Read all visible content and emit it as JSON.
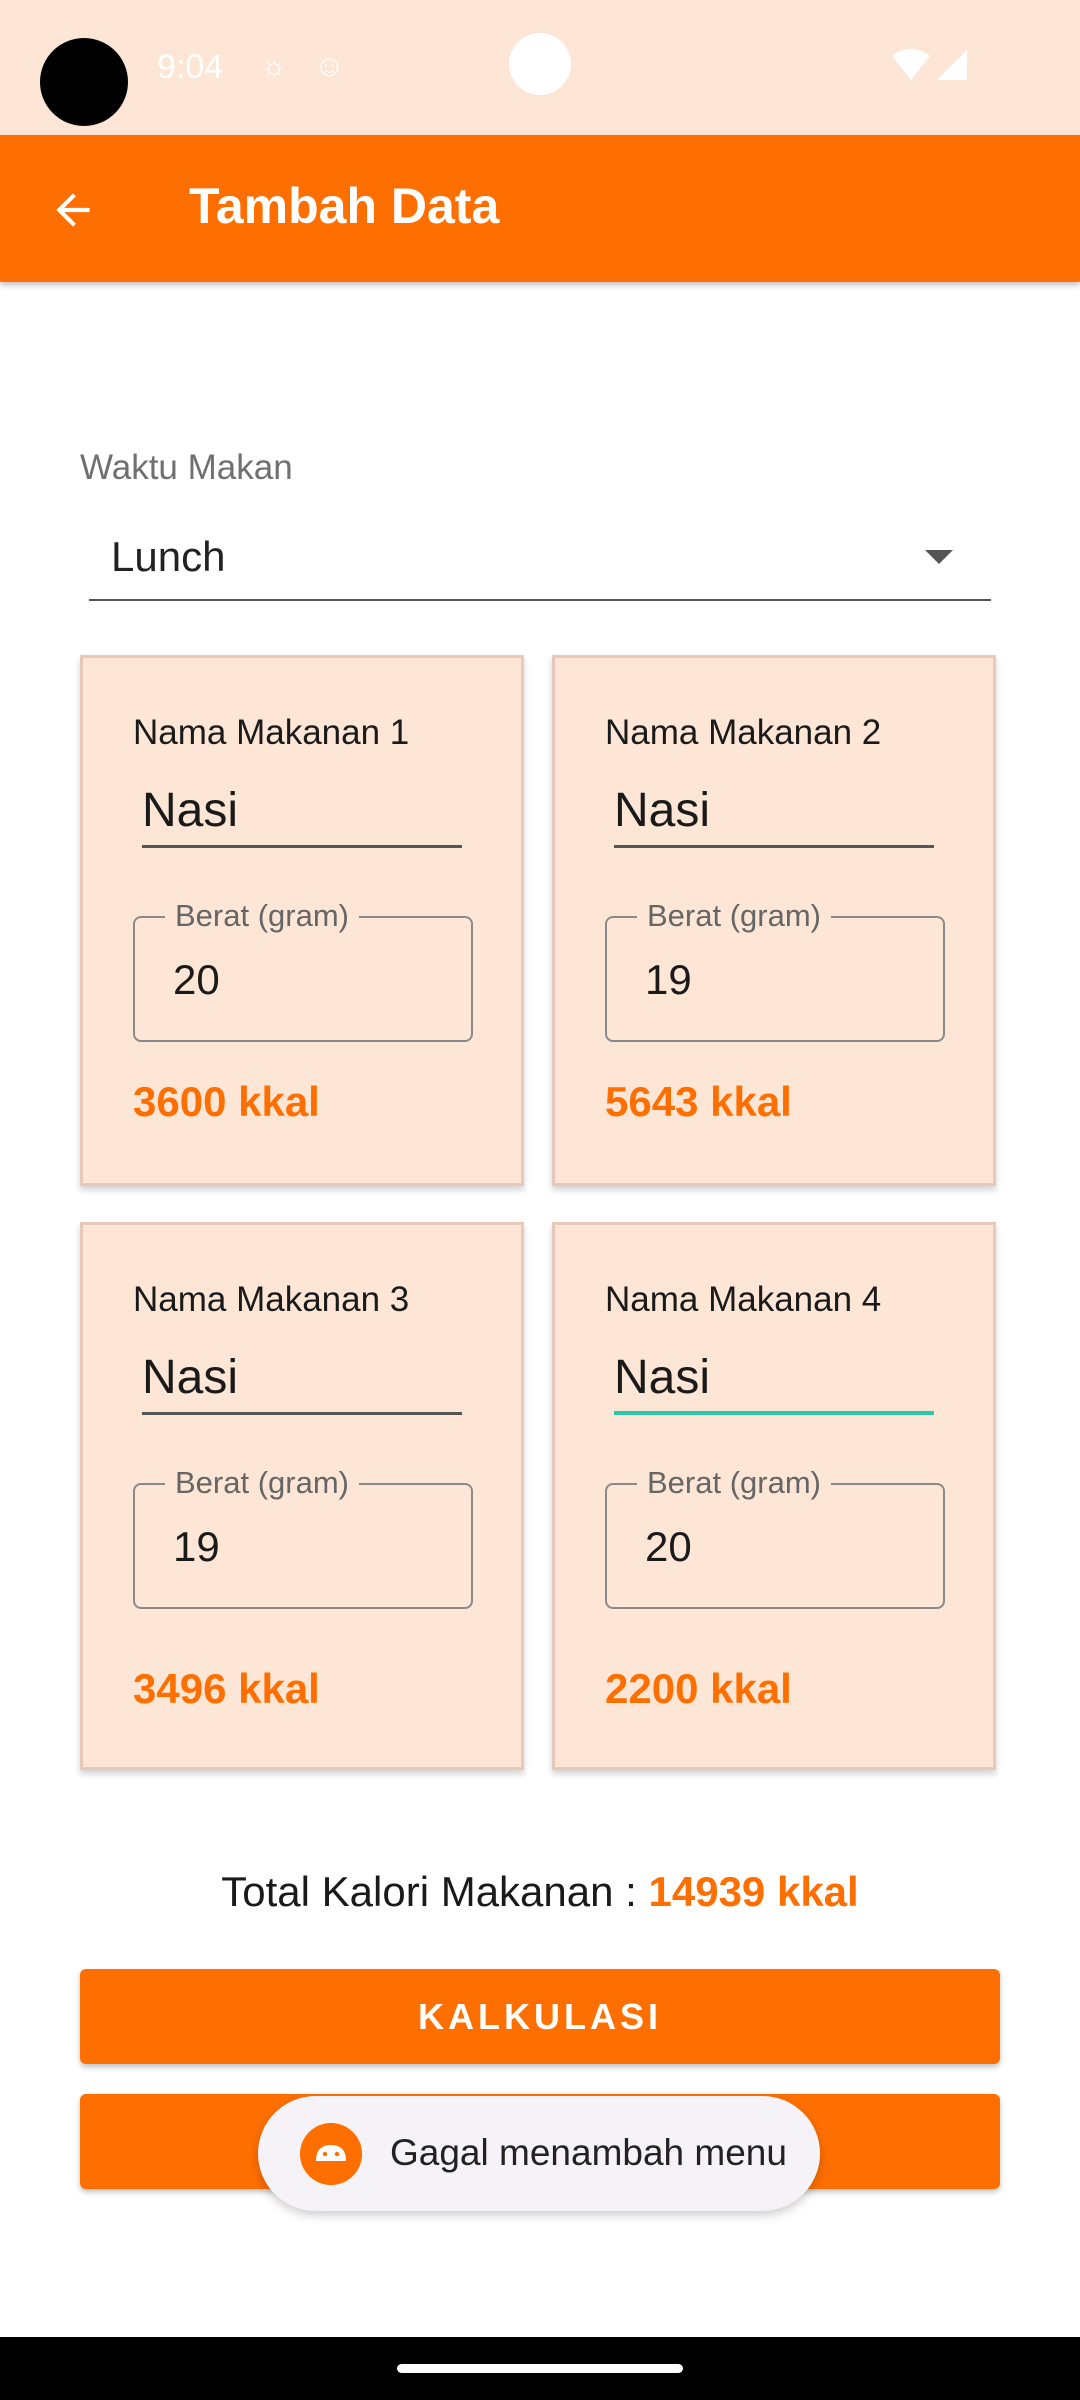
{
  "status_bar": {
    "time": "9:04"
  },
  "app_bar": {
    "title": "Tambah Data"
  },
  "meal_time": {
    "label": "Waktu Makan",
    "selected": "Lunch"
  },
  "foods": [
    {
      "title": "Nama Makanan 1",
      "name": "Nasi",
      "weight_label": "Berat (gram)",
      "weight": "20",
      "kcal": "3600 kkal"
    },
    {
      "title": "Nama Makanan 2",
      "name": "Nasi",
      "weight_label": "Berat (gram)",
      "weight": "19",
      "kcal": "5643 kkal"
    },
    {
      "title": "Nama Makanan 3",
      "name": "Nasi",
      "weight_label": "Berat (gram)",
      "weight": "19",
      "kcal": "3496 kkal"
    },
    {
      "title": "Nama Makanan 4",
      "name": "Nasi",
      "weight_label": "Berat (gram)",
      "weight": "20",
      "kcal": "2200 kkal"
    }
  ],
  "total": {
    "label": "Total Kalori Makanan : ",
    "value": "14939 kkal"
  },
  "buttons": {
    "calculate": "KALKULASI"
  },
  "toast": {
    "message": "Gagal menambah menu"
  },
  "colors": {
    "accent": "#ff6f00",
    "card_bg": "#fde6d6",
    "focus": "#2bc7a6"
  }
}
